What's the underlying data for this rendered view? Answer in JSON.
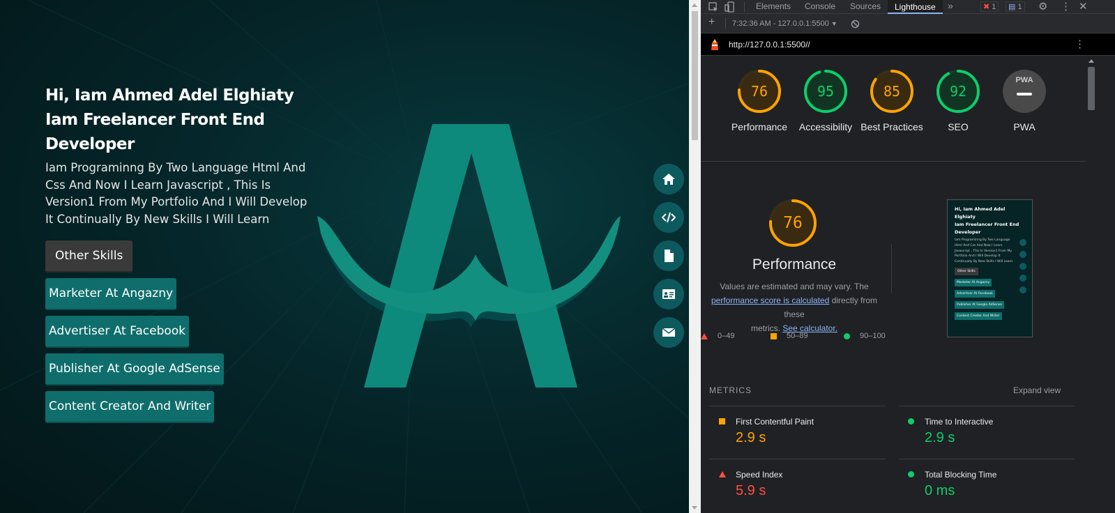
{
  "site": {
    "heading_line1": "Hi, Iam Ahmed Adel Elghiaty",
    "heading_line2": "Iam Freelancer Front End",
    "heading_line3": "Developer",
    "intro": "Iam Programinng By Two Language Html And Css And Now I Learn Javascript , This Is Version1 From My Portfolio And I Will Develop It Continually By New Skills I Will Learn",
    "skills": [
      "Other Skills",
      "Marketer At Angazny",
      "Advertiser At Facebook",
      "Publisher At Google AdSense",
      "Content Creator And Writer"
    ],
    "nav_icons": [
      "home-icon",
      "code-icon",
      "file-icon",
      "id-card-icon",
      "envelope-icon"
    ],
    "accent_color": "#0f6e6c"
  },
  "devtools": {
    "tabs": [
      "Elements",
      "Console",
      "Sources",
      "Lighthouse"
    ],
    "active_tab": "Lighthouse",
    "error_count": "1",
    "message_count": "1",
    "report_time": "7:32:36 AM - 127.0.0.1:5500",
    "url": "http://127.0.0.1:5500//",
    "scores": [
      {
        "label": "Performance",
        "value": 76,
        "display": "76"
      },
      {
        "label": "Accessibility",
        "value": 95,
        "display": "95"
      },
      {
        "label": "Best Practices",
        "value": 85,
        "display": "85"
      },
      {
        "label": "SEO",
        "value": 92,
        "display": "92"
      },
      {
        "label": "PWA",
        "display": "PWA"
      }
    ],
    "perf": {
      "score": "76",
      "title": "Performance",
      "desc_1": "Values are estimated and may vary. The",
      "desc_link": "performance score is calculated",
      "desc_2": "directly from these",
      "desc_3": "metrics.",
      "desc_link2": "See calculator.",
      "legend": [
        "0–49",
        "50–89",
        "90–100"
      ]
    },
    "metrics_title": "METRICS",
    "expand_label": "Expand view",
    "metrics": [
      {
        "name": "First Contentful Paint",
        "value": "2.9 s",
        "status": "average"
      },
      {
        "name": "Time to Interactive",
        "value": "2.9 s",
        "status": "pass"
      },
      {
        "name": "Speed Index",
        "value": "5.9 s",
        "status": "fail"
      },
      {
        "name": "Total Blocking Time",
        "value": "0 ms",
        "status": "pass"
      }
    ],
    "colors": {
      "pass": "#0cce6b",
      "average": "#ffa400",
      "fail": "#ff4e42"
    }
  }
}
